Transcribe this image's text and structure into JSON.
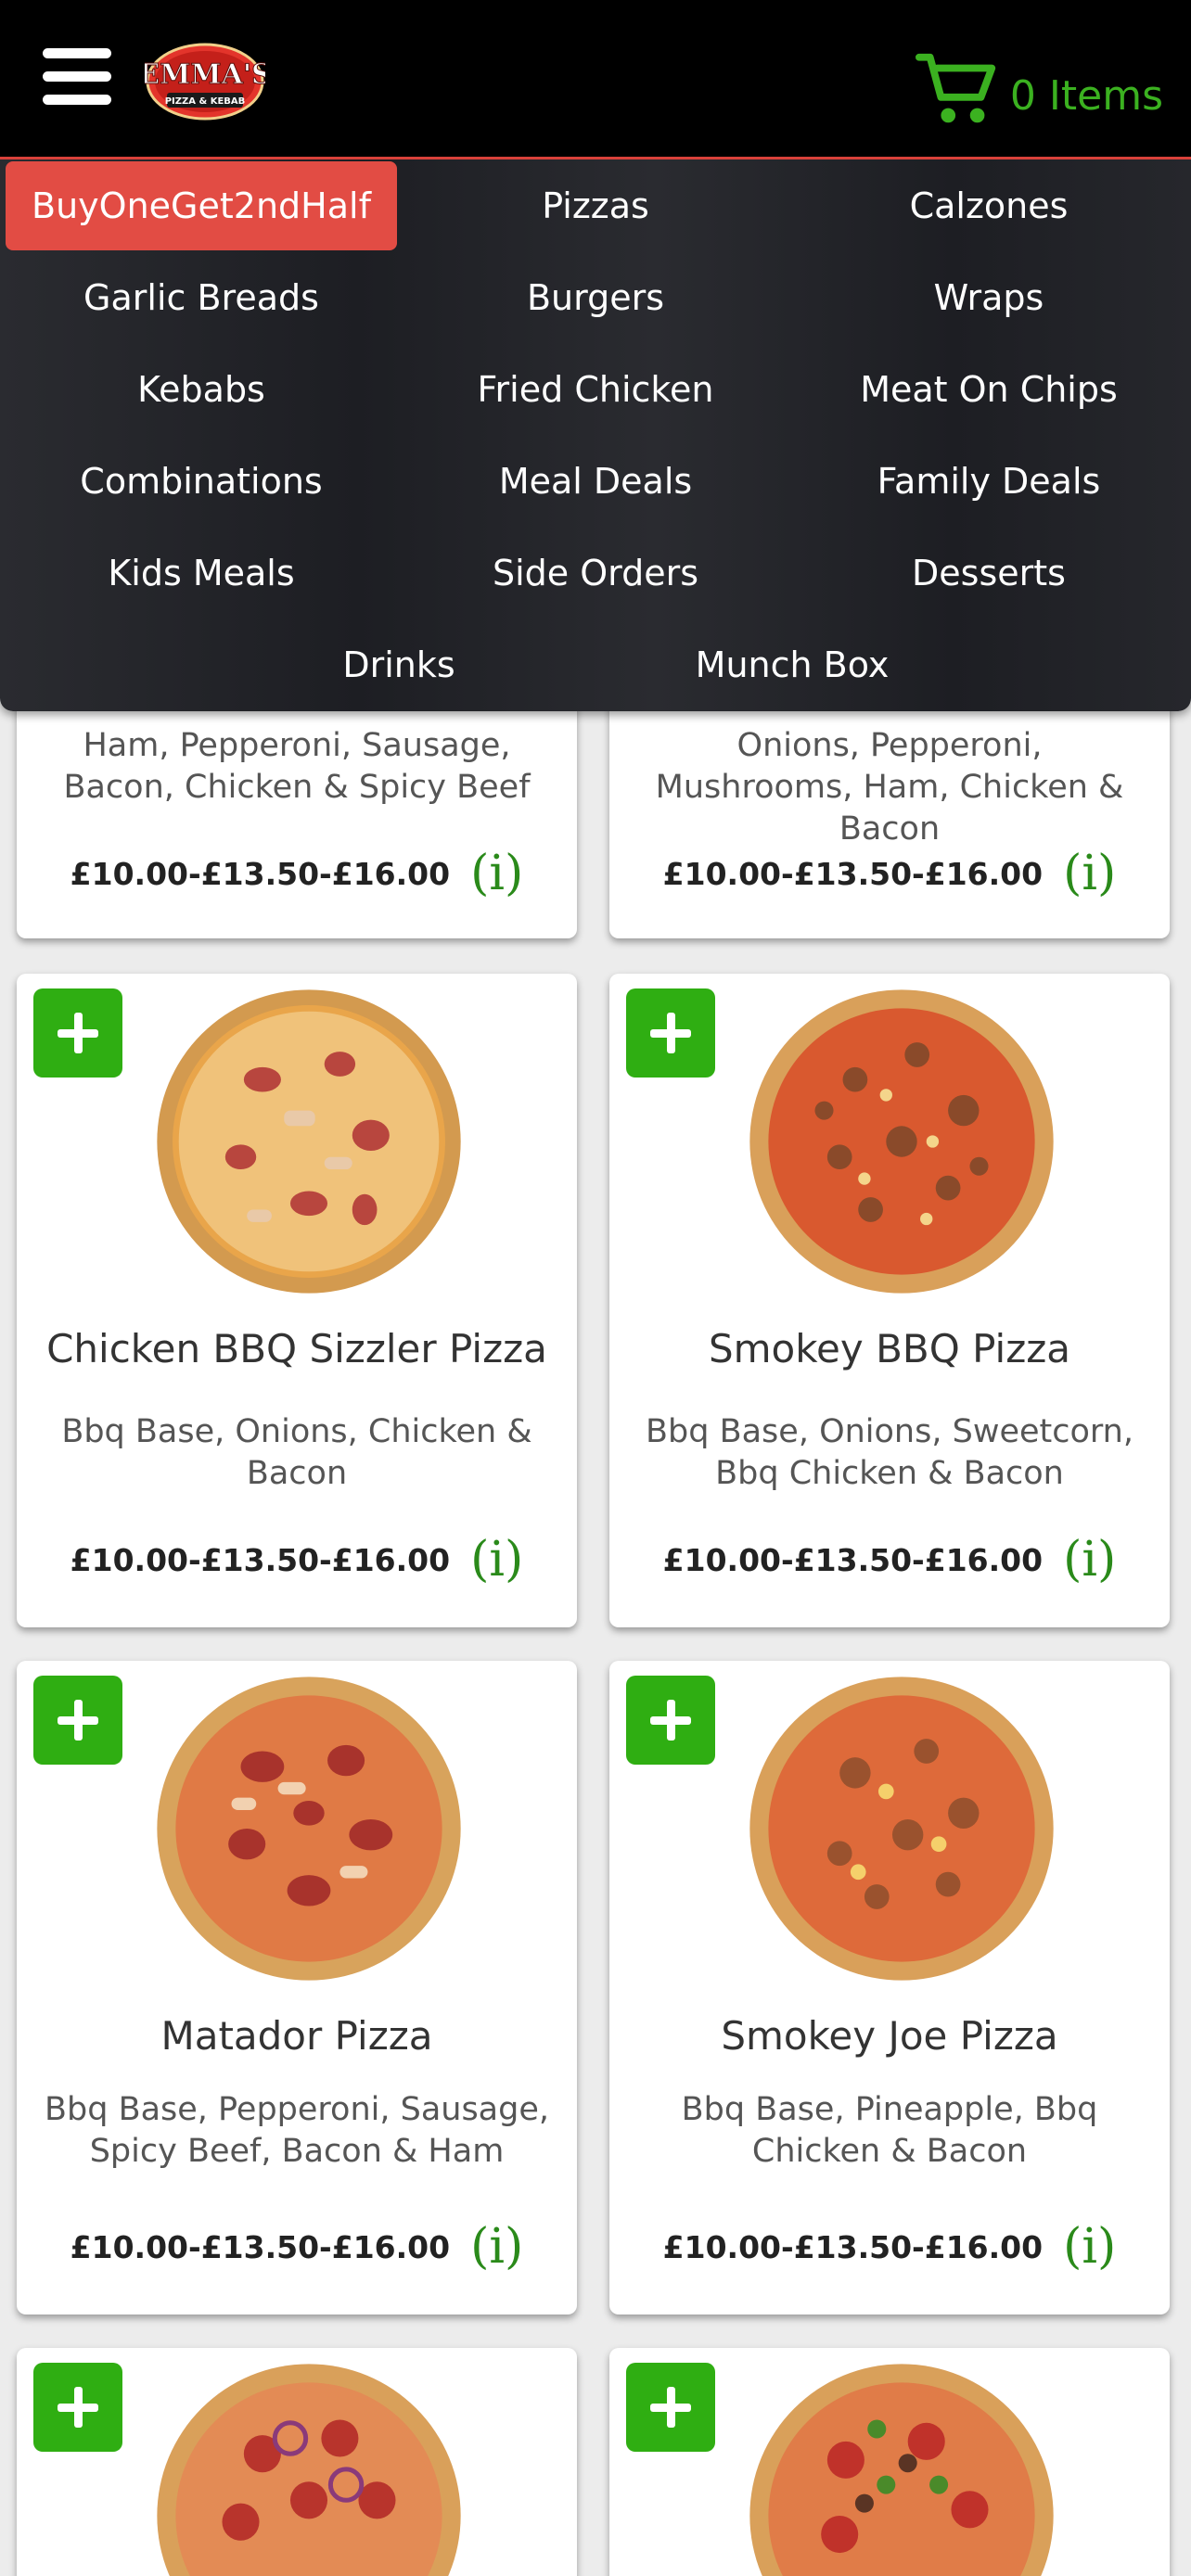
{
  "header": {
    "logo_text": "EMMA'S",
    "logo_sub": "PIZZA & KEBAB",
    "cart_label": "0 Items",
    "brand_color": "#d9413a",
    "cart_color": "#3bb120"
  },
  "menu": {
    "items": [
      {
        "label": "BuyOneGet2ndHalf"
      },
      {
        "label": "Pizzas"
      },
      {
        "label": "Calzones"
      },
      {
        "label": "Garlic Breads"
      },
      {
        "label": "Burgers"
      },
      {
        "label": "Wraps"
      },
      {
        "label": "Kebabs"
      },
      {
        "label": "Fried Chicken"
      },
      {
        "label": "Meat On Chips"
      },
      {
        "label": "Combinations"
      },
      {
        "label": "Meal Deals"
      },
      {
        "label": "Family Deals"
      },
      {
        "label": "Kids Meals"
      },
      {
        "label": "Side Orders"
      },
      {
        "label": "Desserts"
      },
      {
        "label": "Drinks"
      },
      {
        "label": "Munch Box"
      }
    ]
  },
  "products": [
    {
      "title": "",
      "desc": "Ham, Pepperoni, Sausage, Bacon, Chicken & Spicy Beef",
      "price": "£10.00-£13.50-£16.00",
      "info": "(i)"
    },
    {
      "title": "",
      "desc": "Onions, Pepperoni, Mushrooms, Ham, Chicken & Bacon",
      "price": "£10.00-£13.50-£16.00",
      "info": "(i)"
    },
    {
      "title": "Chicken BBQ Sizzler Pizza",
      "desc": "Bbq Base, Onions, Chicken & Bacon",
      "price": "£10.00-£13.50-£16.00",
      "info": "(i)"
    },
    {
      "title": "Smokey BBQ Pizza",
      "desc": "Bbq Base, Onions, Sweetcorn, Bbq Chicken & Bacon",
      "price": "£10.00-£13.50-£16.00",
      "info": "(i)"
    },
    {
      "title": "Matador Pizza",
      "desc": "Bbq Base, Pepperoni, Sausage, Spicy Beef, Bacon & Ham",
      "price": "£10.00-£13.50-£16.00",
      "info": "(i)"
    },
    {
      "title": "Smokey Joe Pizza",
      "desc": "Bbq Base, Pineapple, Bbq Chicken & Bacon",
      "price": "£10.00-£13.50-£16.00",
      "info": "(i)"
    }
  ]
}
